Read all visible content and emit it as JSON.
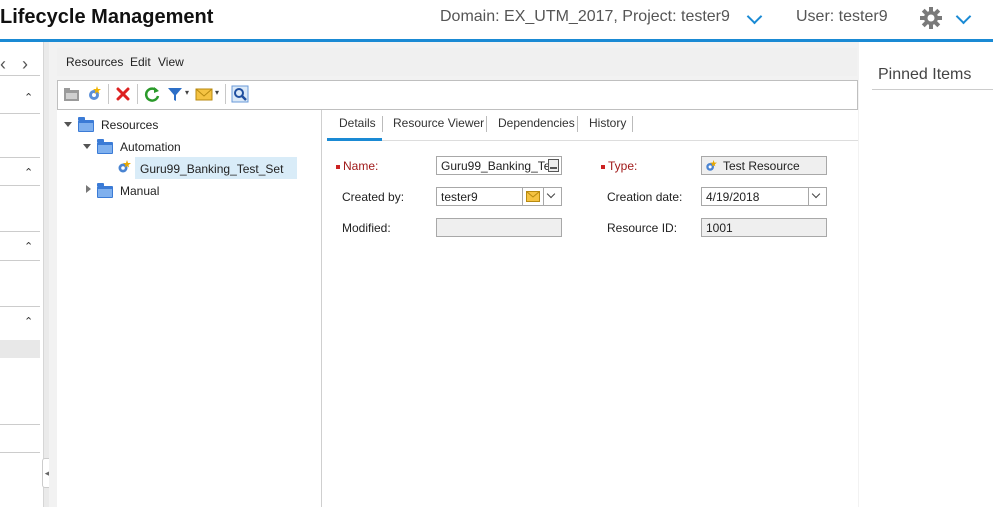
{
  "header": {
    "title": "Lifecycle Management",
    "domain_project": "Domain: EX_UTM_2017, Project: tester9",
    "user": "User: tester9"
  },
  "left_nav": {
    "prev": "‹",
    "next": "›"
  },
  "menu": [
    "Resources",
    "Edit",
    "View"
  ],
  "tree": {
    "root": "Resources",
    "children": [
      {
        "label": "Automation",
        "expanded": true,
        "items": [
          "Guru99_Banking_Test_Set"
        ]
      },
      {
        "label": "Manual",
        "expanded": false
      }
    ]
  },
  "tabs": [
    "Details",
    "Resource Viewer",
    "Dependencies",
    "History"
  ],
  "details": {
    "name_label": "Name:",
    "name_value": "Guru99_Banking_Te",
    "type_label": "Type:",
    "type_value": "Test Resource",
    "created_by_label": "Created by:",
    "created_by_value": "tester9",
    "creation_date_label": "Creation date:",
    "creation_date_value": "4/19/2018",
    "modified_label": "Modified:",
    "modified_value": "",
    "resource_id_label": "Resource ID:",
    "resource_id_value": "1001"
  },
  "pinned": {
    "title": "Pinned Items"
  },
  "colors": {
    "accent": "#1a8ad4",
    "required": "#a01a1a",
    "selection": "#d9ecf8"
  }
}
